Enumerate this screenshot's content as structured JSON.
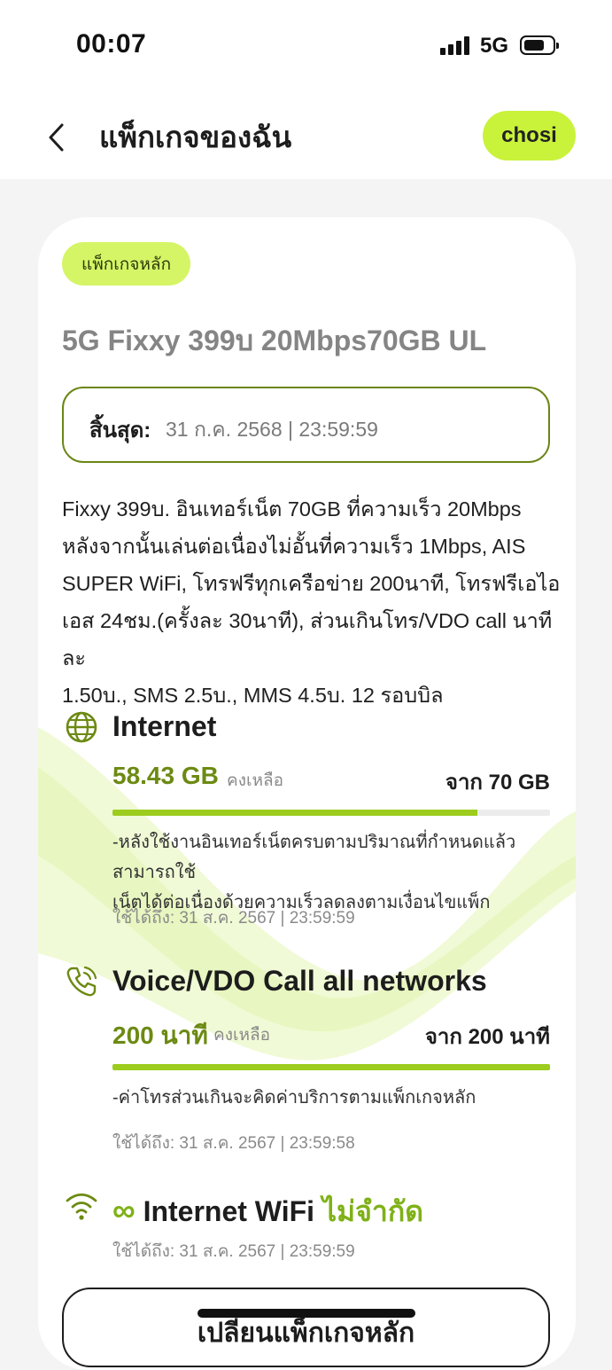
{
  "status_bar": {
    "time": "00:07",
    "network": "5G",
    "battery_percent": 60
  },
  "header": {
    "title": "แพ็กเกจของฉัน",
    "chosi_label": "chosi"
  },
  "package": {
    "badge": "แพ็กเกจหลัก",
    "name": "5G Fixxy 399บ 20Mbps70GB UL",
    "expire_label": "สิ้นสุด:",
    "expire_value": "31 ก.ค. 2568 | 23:59:59",
    "description": [
      "Fixxy 399บ. อินเทอร์เน็ต 70GB ที่ความเร็ว 20Mbps",
      "หลังจากนั้นเล่นต่อเนื่องไม่อั้นที่ความเร็ว 1Mbps, AIS",
      "SUPER WiFi, โทรฟรีทุกเครือข่าย 200นาที, โทรฟรีเอไอ",
      "เอส 24ชม.(ครั้งละ 30นาที), ส่วนเกินโทร/VDO call นาทีละ",
      "1.50บ., SMS 2.5บ., MMS 4.5บ. 12 รอบบิล"
    ]
  },
  "internet": {
    "icon": "globe-icon",
    "title": "Internet",
    "remaining": "58.43 GB",
    "remaining_label": "คงเหลือ",
    "total": "จาก 70 GB",
    "usage_fraction": 0.835,
    "note": [
      "-หลังใช้งานอินเทอร์เน็ตครบตามปริมาณที่กำหนดแล้ว สามารถใช้",
      "เน็ตได้ต่อเนื่องด้วยความเร็วลดลงตามเงื่อนไขแพ็ก"
    ],
    "valid_until": "ใช้ได้ถึง: 31 ส.ค. 2567 | 23:59:59"
  },
  "voice": {
    "icon": "phone-call-icon",
    "title": "Voice/VDO Call all networks",
    "remaining": "200 นาที",
    "remaining_label": "คงเหลือ",
    "total": "จาก 200 นาที",
    "usage_fraction": 1.0,
    "note": "-ค่าโทรส่วนเกินจะคิดค่าบริการตามแพ็กเกจหลัก",
    "valid_until": "ใช้ได้ถึง: 31 ส.ค. 2567 | 23:59:58"
  },
  "wifi": {
    "icon": "wifi-icon",
    "infinity": "∞",
    "title": "Internet WiFi",
    "unlimited": "ไม่จำกัด",
    "valid_until": "ใช้ได้ถึง: 31 ส.ค. 2567 | 23:59:59"
  },
  "change_button": "เปลี่ยนแพ็กเกจหลัก",
  "colors": {
    "accent_lime": "#c9f23a",
    "accent_green": "#6c8a12",
    "bar_green": "#9ccc1d"
  }
}
